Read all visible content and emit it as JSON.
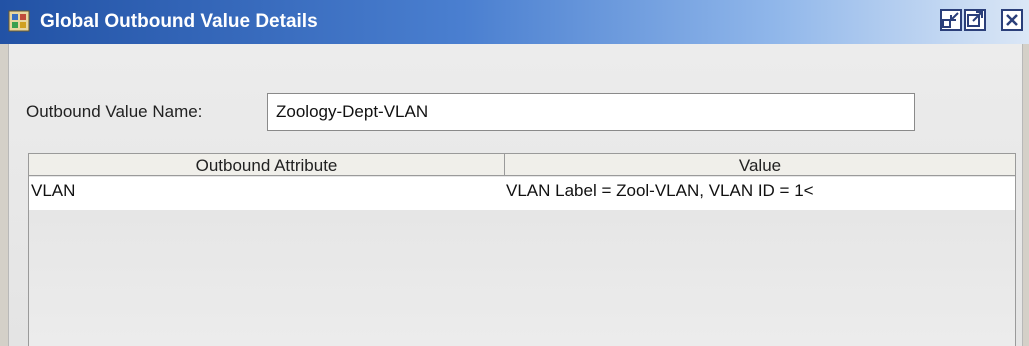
{
  "window": {
    "title": "Global Outbound Value Details",
    "icons": [
      "app-icon",
      "restore-icon",
      "maximize-icon",
      "close-icon"
    ]
  },
  "form": {
    "name_label": "Outbound Value Name:",
    "name_value": "Zoology-Dept-VLAN"
  },
  "table": {
    "columns": [
      "Outbound Attribute",
      "Value"
    ],
    "rows": [
      {
        "attribute": "VLAN",
        "value": "VLAN Label = Zool-VLAN, VLAN ID = 1<"
      }
    ]
  },
  "colors": {
    "titlebar_start": "#2252a5",
    "titlebar_end": "#dbe7f6",
    "panel": "#e6e6e6"
  }
}
